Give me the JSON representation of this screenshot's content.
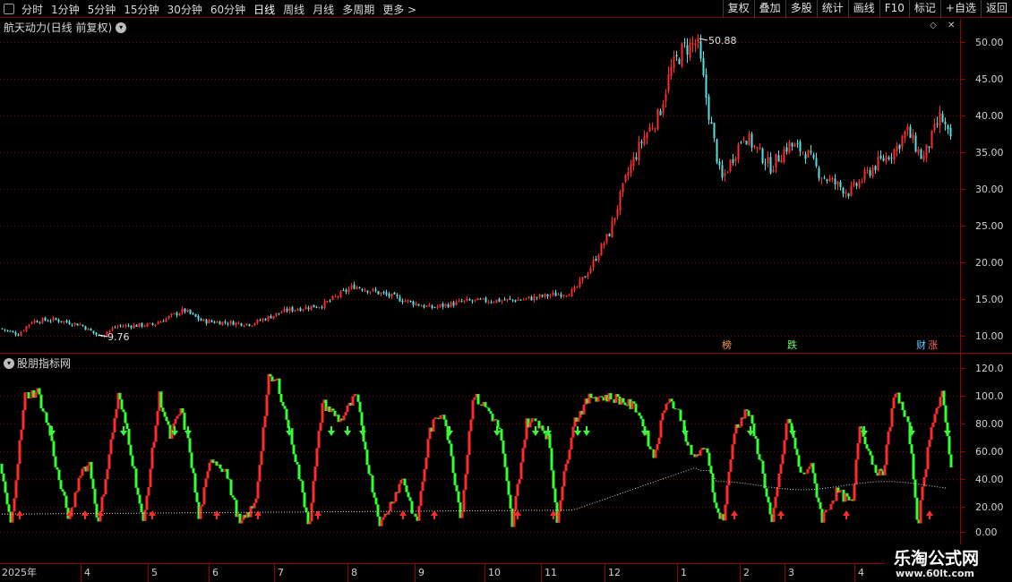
{
  "toolbar": {
    "periods": [
      "分时",
      "1分钟",
      "5分钟",
      "15分钟",
      "30分钟",
      "60分钟",
      "日线",
      "周线",
      "月线",
      "多周期",
      "更多"
    ],
    "active_index": 6,
    "more_arrow": ">",
    "buttons": [
      "复权",
      "叠加",
      "多股",
      "统计",
      "画线",
      "F10",
      "标记",
      "+自选",
      "返回"
    ]
  },
  "main_pane": {
    "title": "航天动力(日线 前复权)",
    "y_ticks": [
      "50.00",
      "45.00",
      "40.00",
      "35.00",
      "30.00",
      "25.00",
      "20.00",
      "15.00",
      "10.00"
    ],
    "max_label": "50.88",
    "min_label": "9.76",
    "badges": [
      "榜",
      "跌",
      "财",
      "涨"
    ]
  },
  "indicator_pane": {
    "title": "股朋指标网",
    "y_ticks": [
      "120.0",
      "100.0",
      "80.00",
      "60.00",
      "40.00",
      "20.00",
      "0.00"
    ]
  },
  "x_axis": {
    "labels": [
      "2025年",
      "4",
      "5",
      "6",
      "7",
      "8",
      "9",
      "10",
      "11",
      "12",
      "1",
      "2",
      "3",
      "4"
    ]
  },
  "watermark": {
    "title": "乐淘公式网",
    "url": "www.60lt.com"
  },
  "colors": {
    "up": "#ff2a2a",
    "down": "#33ff33",
    "price_down": "#53e0e0",
    "grid": "#8a0000",
    "axis_text": "#d0d0d0"
  }
}
